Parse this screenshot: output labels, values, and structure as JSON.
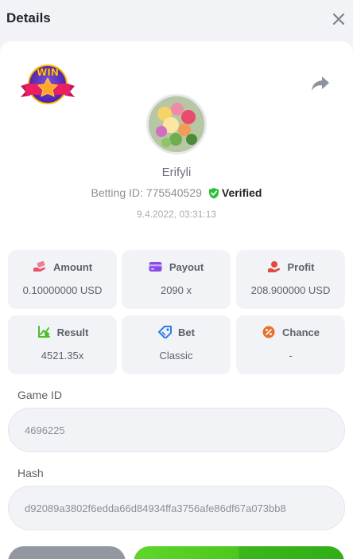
{
  "header": {
    "title": "Details"
  },
  "user": {
    "name": "Erifyli",
    "betting_id": "Betting ID: 775540529",
    "verified": "Verified",
    "date": "9.4.2022, 03:31:13"
  },
  "stats": [
    {
      "label": "Amount",
      "value": "0.10000000 USD",
      "icon": "money-hand-icon",
      "color": "#e8536b"
    },
    {
      "label": "Payout",
      "value": "2090 x",
      "icon": "card-icon",
      "color": "#8a4be8"
    },
    {
      "label": "Profit",
      "value": "208.900000 USD",
      "icon": "coin-hand-icon",
      "color": "#e04b3c"
    },
    {
      "label": "Result",
      "value": "4521.35x",
      "icon": "chart-up-icon",
      "color": "#4cbf2a"
    },
    {
      "label": "Bet",
      "value": "Classic",
      "icon": "ticket-icon",
      "color": "#2f7be6"
    },
    {
      "label": "Chance",
      "value": "-",
      "icon": "percent-icon",
      "color": "#e8702a"
    }
  ],
  "game": {
    "label": "Game ID",
    "value": "4696225"
  },
  "hash": {
    "label": "Hash",
    "value": "d92089a3802f6edda66d84934ffa3756afe86df67a073bb8"
  },
  "colors": {
    "accent_green": "#4cc81d",
    "panel_bg": "#f2f3f6"
  }
}
